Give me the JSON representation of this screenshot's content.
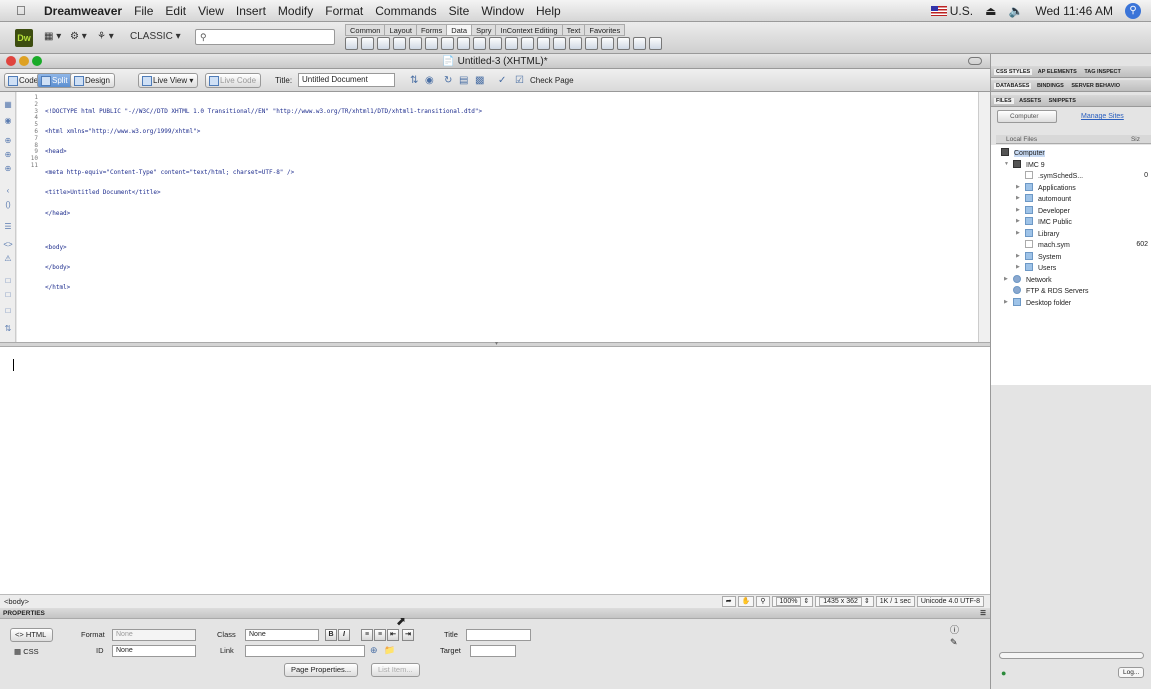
{
  "menubar": {
    "app_name": "Dreamweaver",
    "menus": [
      "File",
      "Edit",
      "View",
      "Insert",
      "Modify",
      "Format",
      "Commands",
      "Site",
      "Window",
      "Help"
    ],
    "input_source": "U.S.",
    "clock": "Wed 11:46 AM"
  },
  "apptoolbar": {
    "logo": "Dw",
    "workspace": "CLASSIC",
    "insert_tabs": [
      "Common",
      "Layout",
      "Forms",
      "Data",
      "Spry",
      "InContext Editing",
      "Text",
      "Favorites"
    ],
    "active_insert_tab": "Data"
  },
  "document": {
    "window_title": "Untitled-3 (XHTML)*",
    "view_buttons": {
      "code": "Code",
      "split": "Split",
      "design": "Design",
      "live_view": "Live View",
      "live_code": "Live Code"
    },
    "title_label": "Title:",
    "title_value": "Untitled Document",
    "check_page": "Check Page",
    "code_lines": [
      "<!DOCTYPE html PUBLIC \"-//W3C//DTD XHTML 1.0 Transitional//EN\" \"http://www.w3.org/TR/xhtml1/DTD/xhtml1-transitional.dtd\">",
      "<html xmlns=\"http://www.w3.org/1999/xhtml\">",
      "<head>",
      "<meta http-equiv=\"Content-Type\" content=\"text/html; charset=UTF-8\" />",
      "<title>Untitled Document</title>",
      "</head>",
      "",
      "<body>",
      "</body>",
      "</html>",
      ""
    ],
    "line_numbers": [
      "1",
      "2",
      "3",
      "4",
      "5",
      "6",
      "7",
      "8",
      "9",
      "10",
      "11"
    ],
    "status_tag": "<body>",
    "zoom": "100%",
    "window_size": "1435 x 362",
    "download": "1K / 1 sec",
    "encoding": "Unicode 4.0 UTF-8"
  },
  "properties": {
    "header": "PROPERTIES",
    "html_tab": "HTML",
    "css_tab": "CSS",
    "format_label": "Format",
    "format_value": "None",
    "class_label": "Class",
    "class_value": "None",
    "id_label": "ID",
    "id_value": "None",
    "link_label": "Link",
    "title_label": "Title",
    "target_label": "Target",
    "page_properties": "Page Properties...",
    "list_item": "List Item..."
  },
  "right_panel": {
    "tabs_row1": [
      "CSS STYLES",
      "AP ELEMENTS",
      "TAG INSPECT"
    ],
    "tabs_row2": [
      "DATABASES",
      "BINDINGS",
      "SERVER BEHAVIO"
    ],
    "tabs_row3": [
      "FILES",
      "ASSETS",
      "SNIPPETS"
    ],
    "site_select": "Computer",
    "manage_sites": "Manage Sites",
    "local_files": "Local Files",
    "size_col": "Siz",
    "tree": [
      {
        "label": "Computer",
        "level": 0,
        "type": "computer"
      },
      {
        "label": "IMC 9",
        "level": 1,
        "type": "disk"
      },
      {
        "label": ".symSchedS...",
        "level": 2,
        "type": "file",
        "size": "0"
      },
      {
        "label": "Applications",
        "level": 2,
        "type": "folder"
      },
      {
        "label": "automount",
        "level": 2,
        "type": "folder"
      },
      {
        "label": "Developer",
        "level": 2,
        "type": "folder"
      },
      {
        "label": "IMC Public",
        "level": 2,
        "type": "folder"
      },
      {
        "label": "Library",
        "level": 2,
        "type": "folder"
      },
      {
        "label": "mach.sym",
        "level": 2,
        "type": "file",
        "size": "602"
      },
      {
        "label": "System",
        "level": 2,
        "type": "folder"
      },
      {
        "label": "Users",
        "level": 2,
        "type": "folder"
      },
      {
        "label": "Network",
        "level": 1,
        "type": "network"
      },
      {
        "label": "FTP & RDS Servers",
        "level": 1,
        "type": "server"
      },
      {
        "label": "Desktop folder",
        "level": 1,
        "type": "folder"
      }
    ],
    "log_button": "Log..."
  }
}
